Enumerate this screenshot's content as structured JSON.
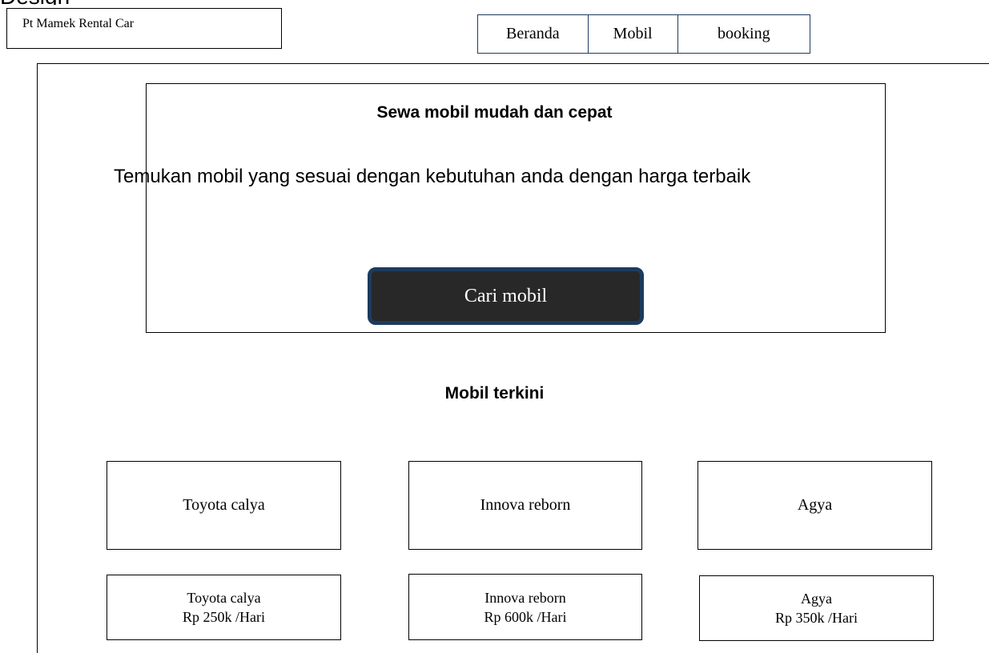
{
  "brand": {
    "name": "Pt Mamek Rental Car"
  },
  "nav": {
    "items": [
      "Beranda",
      "Mobil",
      "booking"
    ]
  },
  "hero": {
    "title": "Sewa mobil mudah dan cepat",
    "subtitle": "Temukan mobil yang sesuai dengan kebutuhan anda dengan harga terbaik",
    "cta_label": "Cari mobil"
  },
  "section": {
    "title": "Mobil terkini"
  },
  "cars": [
    {
      "name": "Toyota calya",
      "price": "Rp 250k /Hari"
    },
    {
      "name": "Innova reborn",
      "price": "Rp 600k /Hari"
    },
    {
      "name": "Agya",
      "price": "Rp 350k /Hari"
    }
  ],
  "colors": {
    "button_bg": "#282828",
    "button_border": "#1d3b5c",
    "nav_border": "#1f3a5f"
  }
}
